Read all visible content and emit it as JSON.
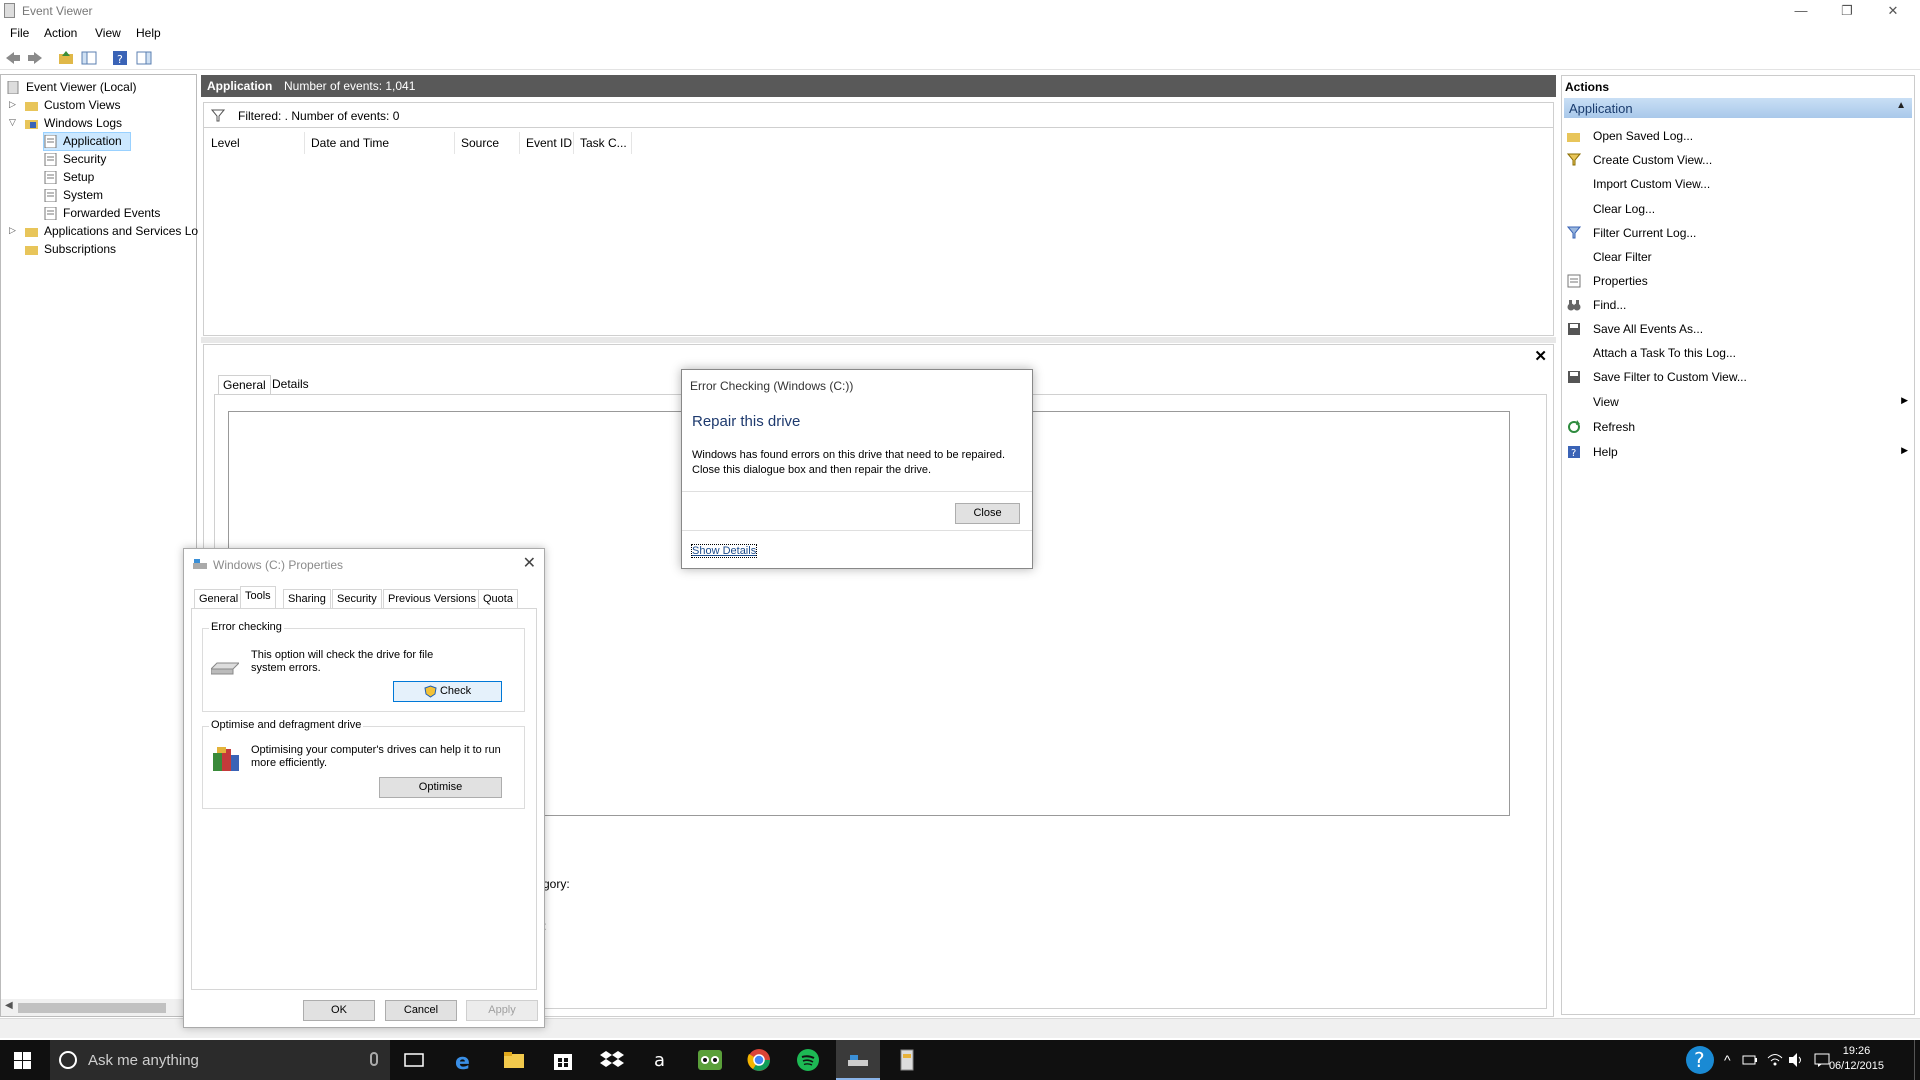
{
  "window": {
    "title": "Event Viewer",
    "min": "—",
    "max": "❐",
    "close": "✕"
  },
  "menu": [
    "File",
    "Action",
    "View",
    "Help"
  ],
  "tree": {
    "root": "Event Viewer (Local)",
    "custom_views": "Custom Views",
    "windows_logs": "Windows Logs",
    "logs": [
      "Application",
      "Security",
      "Setup",
      "System",
      "Forwarded Events"
    ],
    "apps_services": "Applications and Services Lo",
    "subscriptions": "Subscriptions"
  },
  "log_header": {
    "name": "Application",
    "count": "Number of events: 1,041"
  },
  "filter": {
    "text": "Filtered: . Number of events: 0"
  },
  "columns": [
    "Level",
    "Date and Time",
    "Source",
    "Event ID",
    "Task C..."
  ],
  "details": {
    "tabs": [
      "General",
      "Details"
    ],
    "close": "✕",
    "fragment1": "gory:",
    "fragment2": ":"
  },
  "actions": {
    "header": "Actions",
    "section": "Application",
    "items": [
      "Open Saved Log...",
      "Create Custom View...",
      "Import Custom View...",
      "Clear Log...",
      "Filter Current Log...",
      "Clear Filter",
      "Properties",
      "Find...",
      "Save All Events As...",
      "Attach a Task To this Log...",
      "Save Filter to Custom View...",
      "View",
      "Refresh",
      "Help"
    ]
  },
  "props_dialog": {
    "title": "Windows (C:) Properties",
    "tabs": [
      "General",
      "Tools",
      "Sharing",
      "Security",
      "Previous Versions",
      "Quota"
    ],
    "error_group": "Error checking",
    "error_text": "This option will check the drive for file system errors.",
    "check_btn": "Check",
    "optimise_group": "Optimise and defragment drive",
    "optimise_text": "Optimising your computer's drives can help it to run more efficiently.",
    "optimise_btn": "Optimise",
    "ok": "OK",
    "cancel": "Cancel",
    "apply": "Apply"
  },
  "error_dialog": {
    "title": "Error Checking (Windows (C:))",
    "heading": "Repair this drive",
    "message": "Windows has found errors on this drive that need to be repaired. Close this dialogue box and then repair the drive.",
    "close_btn": "Close",
    "details_link": "Show Details"
  },
  "taskbar": {
    "search_placeholder": "Ask me anything",
    "time": "19:26",
    "date": "06/12/2015"
  }
}
